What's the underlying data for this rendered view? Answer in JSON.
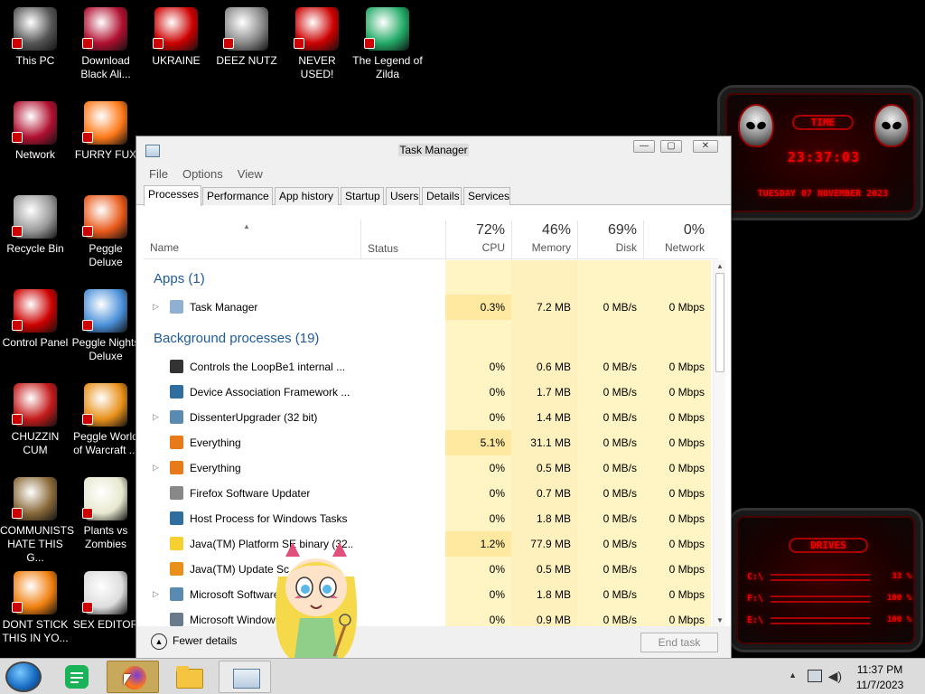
{
  "desktop_icons": [
    {
      "label": "This PC"
    },
    {
      "label": "Download Black Ali..."
    },
    {
      "label": "UKRAINE"
    },
    {
      "label": "DEEZ NUTZ"
    },
    {
      "label": "NEVER USED!"
    },
    {
      "label": "The Legend of Zilda"
    },
    {
      "label": "Network"
    },
    {
      "label": "FURRY FUX"
    },
    {
      "label": "Recycle Bin"
    },
    {
      "label": "Peggle Deluxe"
    },
    {
      "label": "Control Panel"
    },
    {
      "label": "Peggle Nights Deluxe"
    },
    {
      "label": "CHUZZIN CUM"
    },
    {
      "label": "Peggle World of Warcraft ..."
    },
    {
      "label": "COMMUNISTS HATE THIS G..."
    },
    {
      "label": "Plants vs Zombies"
    },
    {
      "label": "DONT STICK THIS IN YO..."
    },
    {
      "label": "SEX EDITOR"
    }
  ],
  "widgets": {
    "clock": {
      "title": "TIME",
      "time": "23:37:03",
      "date": "TUESDAY 07 NOVEMBER 2023"
    },
    "drives": {
      "title": "DRIVES",
      "rows": [
        {
          "letter": "C:\\",
          "value": "33 %"
        },
        {
          "letter": "F:\\",
          "value": "100 %"
        },
        {
          "letter": "E:\\",
          "value": "100 %"
        }
      ]
    }
  },
  "task_manager": {
    "title": "Task Manager",
    "window_buttons": {
      "minimize": "—",
      "maximize": "▢",
      "close": "✕"
    },
    "menu": [
      "File",
      "Options",
      "View"
    ],
    "tabs": [
      "Processes",
      "Performance",
      "App history",
      "Startup",
      "Users",
      "Details",
      "Services"
    ],
    "columns": {
      "name": "Name",
      "status": "Status",
      "cpu": {
        "pct": "72%",
        "label": "CPU"
      },
      "memory": {
        "pct": "46%",
        "label": "Memory"
      },
      "disk": {
        "pct": "69%",
        "label": "Disk"
      },
      "network": {
        "pct": "0%",
        "label": "Network"
      }
    },
    "groups": {
      "apps": "Apps (1)",
      "background": "Background processes (19)"
    },
    "apps": [
      {
        "name": "Task Manager",
        "cpu": "0.3%",
        "memory": "7.2 MB",
        "disk": "0 MB/s",
        "network": "0 Mbps",
        "expandable": true
      }
    ],
    "background": [
      {
        "name": "Controls the LoopBe1 internal ...",
        "cpu": "0%",
        "memory": "0.6 MB",
        "disk": "0 MB/s",
        "network": "0 Mbps",
        "expandable": false
      },
      {
        "name": "Device Association Framework ...",
        "cpu": "0%",
        "memory": "1.7 MB",
        "disk": "0 MB/s",
        "network": "0 Mbps",
        "expandable": false
      },
      {
        "name": "DissenterUpgrader (32 bit)",
        "cpu": "0%",
        "memory": "1.4 MB",
        "disk": "0 MB/s",
        "network": "0 Mbps",
        "expandable": true
      },
      {
        "name": "Everything",
        "cpu": "5.1%",
        "memory": "31.1 MB",
        "disk": "0 MB/s",
        "network": "0 Mbps",
        "expandable": false
      },
      {
        "name": "Everything",
        "cpu": "0%",
        "memory": "0.5 MB",
        "disk": "0 MB/s",
        "network": "0 Mbps",
        "expandable": true
      },
      {
        "name": "Firefox Software Updater",
        "cpu": "0%",
        "memory": "0.7 MB",
        "disk": "0 MB/s",
        "network": "0 Mbps",
        "expandable": false
      },
      {
        "name": "Host Process for Windows Tasks",
        "cpu": "0%",
        "memory": "1.8 MB",
        "disk": "0 MB/s",
        "network": "0 Mbps",
        "expandable": false
      },
      {
        "name": "Java(TM) Platform SE binary (32...",
        "cpu": "1.2%",
        "memory": "77.9 MB",
        "disk": "0 MB/s",
        "network": "0 Mbps",
        "expandable": false
      },
      {
        "name": "Java(TM) Update Sc",
        "cpu": "0%",
        "memory": "0.5 MB",
        "disk": "0 MB/s",
        "network": "0 Mbps",
        "expandable": false
      },
      {
        "name": "Microsoft Software",
        "cpu": "0%",
        "memory": "1.8 MB",
        "disk": "0 MB/s",
        "network": "0 Mbps",
        "expandable": true
      },
      {
        "name": "Microsoft Window",
        "cpu": "0%",
        "memory": "0.9 MB",
        "disk": "0 MB/s",
        "network": "0 Mbps",
        "expandable": false
      }
    ],
    "fewer_details": "Fewer details",
    "end_task": "End task"
  },
  "taskbar": {
    "items": [
      "start-orb",
      "notes-app",
      "firefox",
      "file-explorer",
      "task-manager"
    ],
    "clock_time": "11:37 PM",
    "clock_date": "11/7/2023"
  }
}
